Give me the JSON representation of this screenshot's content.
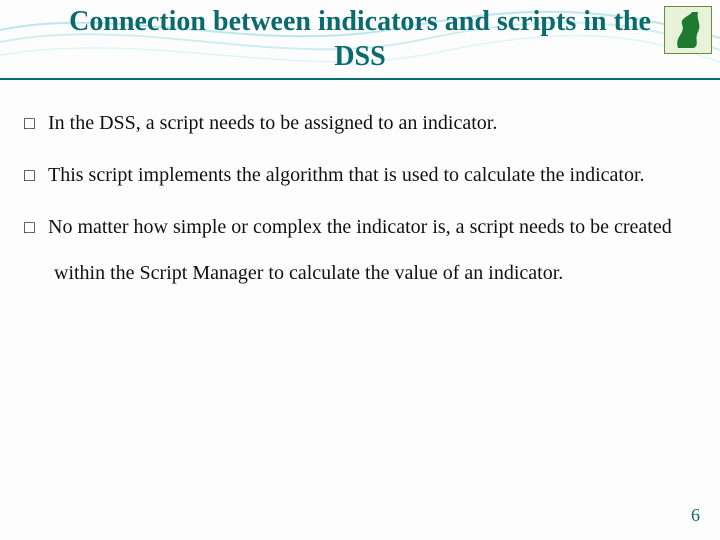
{
  "title": "Connection between indicators and scripts in the DSS",
  "bullets": [
    "In the DSS, a script needs to be assigned to an indicator.",
    "This script implements the algorithm that is used to calculate the indicator.",
    "No matter how simple or complex the indicator is, a script needs to be created within the Script Manager to calculate the value of an indicator."
  ],
  "page_number": "6",
  "colors": {
    "title": "#0a6a6d",
    "body_text": "#111111",
    "wave": "#bfe6ea"
  },
  "icons": {
    "bullet_marker": "hollow-square",
    "header_decoration": "wave-lines",
    "logo": "green-s-curve-on-pale-green"
  }
}
